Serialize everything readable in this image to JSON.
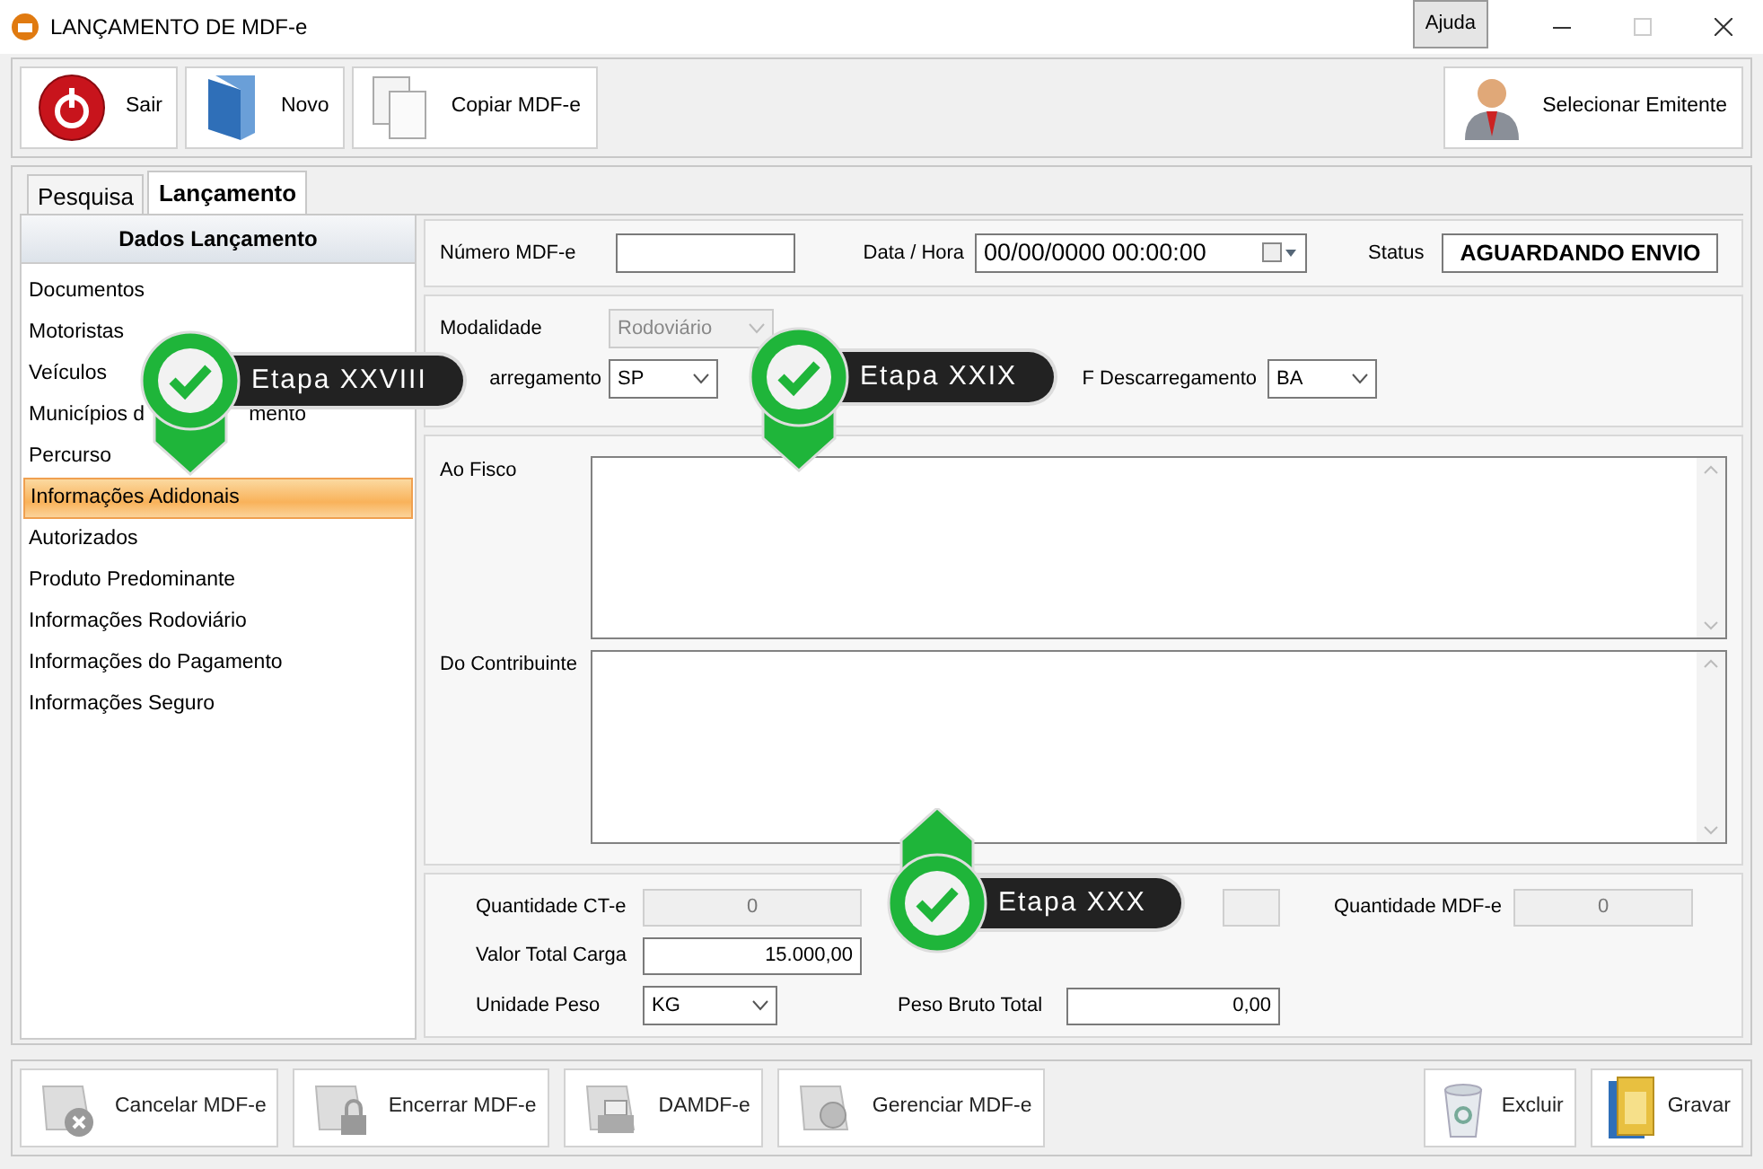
{
  "window": {
    "title": "LANÇAMENTO DE MDF-e",
    "help_button": "Ajuda",
    "maximize_disabled": true
  },
  "toolbar": {
    "left": [
      {
        "label": "Sair"
      },
      {
        "label": "Novo"
      },
      {
        "label": "Copiar MDF-e"
      }
    ],
    "right": [
      {
        "label": "Selecionar Emitente"
      }
    ]
  },
  "tabs": [
    {
      "label": "Pesquisa",
      "selected": false
    },
    {
      "label": "Lançamento",
      "selected": true
    }
  ],
  "sidebar": {
    "title": "Dados Lançamento",
    "items": [
      {
        "label": "Documentos",
        "selected": false
      },
      {
        "label": "Motoristas",
        "selected": false
      },
      {
        "label": "Veículos",
        "selected": false
      },
      {
        "label": "Municípios d",
        "label_tail": "mento",
        "selected": false
      },
      {
        "label": "Percurso",
        "selected": false
      },
      {
        "label": "Informações Adidonais",
        "selected": true
      },
      {
        "label": "Autorizados",
        "selected": false
      },
      {
        "label": "Produto Predominante",
        "selected": false
      },
      {
        "label": "Informações Rodoviário",
        "selected": false
      },
      {
        "label": "Informações do Pagamento",
        "selected": false
      },
      {
        "label": "Informações Seguro",
        "selected": false
      }
    ]
  },
  "header": {
    "numero_label": "Número MDF-e",
    "data_label": "Data / Hora",
    "data_value": "00/00/0000 00:00:00",
    "status_label": "Status",
    "status_value": "AGUARDANDO ENVIO"
  },
  "modal": {
    "modalidade_label": "Modalidade",
    "modalidade_value": "Rodoviário",
    "modalidade_disabled": true,
    "carregamento_label": "arregamento",
    "carregamento_value": "SP",
    "descarregamento_label": "F Descarregamento",
    "descarregamento_value": "BA"
  },
  "info": {
    "fisco_label": "Ao Fisco",
    "contribuinte_label": "Do Contribuinte"
  },
  "totals": {
    "qtd_cte_label": "Quantidade CT-e",
    "qtd_cte_value": "0",
    "qtd_mdfe_label": "Quantidade MDF-e",
    "qtd_mdfe_value": "0",
    "valor_label": "Valor Total Carga",
    "valor_value": "15.000,00",
    "unidade_label": "Unidade Peso",
    "unidade_value": "KG",
    "peso_label": "Peso Bruto Total",
    "peso_value": "0,00"
  },
  "actions": {
    "left": [
      {
        "label": "Cancelar MDF-e"
      },
      {
        "label": "Encerrar MDF-e"
      },
      {
        "label": "DAMDF-e"
      },
      {
        "label": "Gerenciar MDF-e"
      }
    ],
    "right": [
      {
        "label": "Excluir"
      },
      {
        "label": "Gravar"
      }
    ]
  },
  "callouts": [
    {
      "label": "Etapa XXVIII"
    },
    {
      "label": "Etapa XXIX"
    },
    {
      "label": "Etapa XXX"
    }
  ]
}
